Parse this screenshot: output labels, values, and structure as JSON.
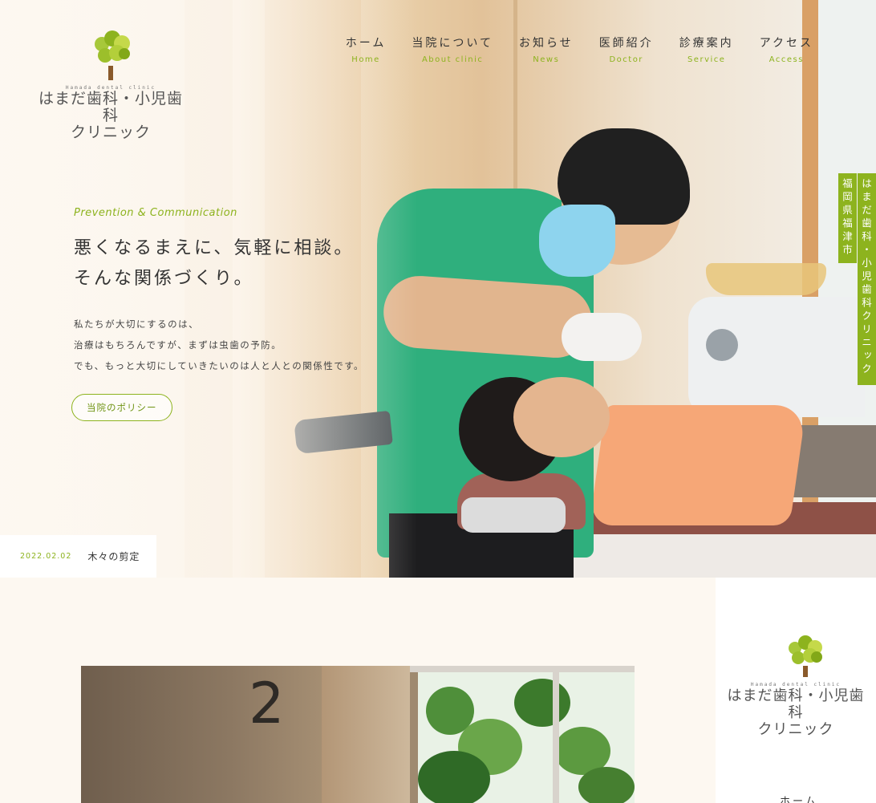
{
  "brand": {
    "sub": "Hamada dental clinic",
    "title_line1": "はまだ歯科・小児歯科",
    "title_line2": "クリニック",
    "colors": {
      "accent": "#8db31e",
      "bg": "#fdf8f1"
    }
  },
  "nav": [
    {
      "jp": "ホーム",
      "en": "Home"
    },
    {
      "jp": "当院について",
      "en": "About clinic"
    },
    {
      "jp": "お知らせ",
      "en": "News"
    },
    {
      "jp": "医師紹介",
      "en": "Doctor"
    },
    {
      "jp": "診療案内",
      "en": "Service"
    },
    {
      "jp": "アクセス",
      "en": "Access"
    }
  ],
  "side_tabs": {
    "location": "福岡県福津市",
    "clinic": "はまだ歯科・小児歯科クリニック"
  },
  "hero": {
    "tagline": "Prevention & Communication",
    "headline_1": "悪くなるまえに、気軽に相談。",
    "headline_2": "そんな関係づくり。",
    "lead_1": "私たちが大切にするのは、",
    "lead_2": "治療はもちろんですが、まずは虫歯の予防。",
    "lead_3": "でも、もっと大切にしていきたいのは人と人との関係性です。",
    "button": "当院のポリシー"
  },
  "news": {
    "date": "2022.02.02",
    "title": "木々の剪定"
  },
  "lower": {
    "room_number": "2",
    "right_nav_first": "ホーム"
  }
}
